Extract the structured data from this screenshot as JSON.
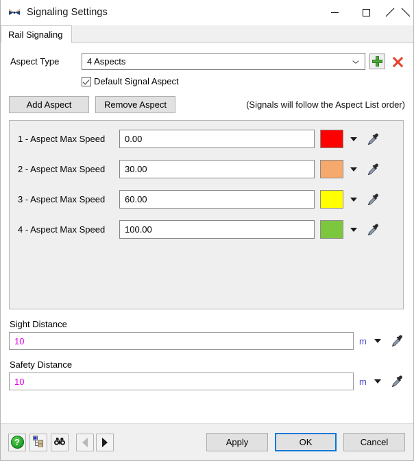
{
  "window": {
    "title": "Signaling Settings",
    "icon": "signal-crossing-icon",
    "minimize_label": "Minimize",
    "maximize_label": "Maximize",
    "close_label": "Close"
  },
  "tabs": [
    {
      "label": "Rail Signaling",
      "active": true
    }
  ],
  "aspect_type": {
    "label": "Aspect Type",
    "value": "4 Aspects",
    "add_icon": "plus-icon",
    "delete_icon": "x-mark-icon"
  },
  "default_signal_aspect": {
    "label": "Default Signal Aspect",
    "checked": true
  },
  "aspect_actions": {
    "add_label": "Add Aspect",
    "remove_label": "Remove Aspect",
    "hint": "(Signals will follow the Aspect List order)"
  },
  "aspects": [
    {
      "label": "1 - Aspect Max Speed",
      "value": "0.00",
      "color": "#FF0000"
    },
    {
      "label": "2 - Aspect Max Speed",
      "value": "30.00",
      "color": "#F6A96C"
    },
    {
      "label": "3 - Aspect Max Speed",
      "value": "60.00",
      "color": "#FFFF00"
    },
    {
      "label": "4 - Aspect Max Speed",
      "value": "100.00",
      "color": "#7DC73F"
    }
  ],
  "sight_distance": {
    "label": "Sight Distance",
    "value": "10",
    "unit": "m",
    "value_color": "#E200E2",
    "unit_color": "#4A4AD2"
  },
  "safety_distance": {
    "label": "Safety Distance",
    "value": "10",
    "unit": "m",
    "value_color": "#E200E2",
    "unit_color": "#4A4AD2"
  },
  "footer": {
    "help_label": "?",
    "tools": [
      {
        "name": "help-icon"
      },
      {
        "name": "hierarchy-tree-icon"
      },
      {
        "name": "binoculars-icon"
      },
      {
        "name": "previous-arrow-icon"
      },
      {
        "name": "next-arrow-icon"
      }
    ],
    "apply_label": "Apply",
    "ok_label": "OK",
    "cancel_label": "Cancel",
    "default_button": "OK"
  }
}
